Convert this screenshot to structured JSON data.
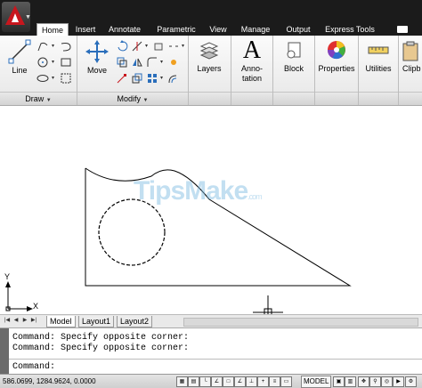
{
  "tabs": [
    "Home",
    "Insert",
    "Annotate",
    "Parametric",
    "View",
    "Manage",
    "Output",
    "Express Tools"
  ],
  "active_tab": "Home",
  "ribbon": {
    "draw_panel_label": "Draw",
    "modify_panel_label": "Modify",
    "line_label": "Line",
    "move_label": "Move",
    "layers_label": "Layers",
    "annotation_label_1": "Anno-",
    "annotation_label_2": "tation",
    "annotation_glyph": "A",
    "block_label": "Block",
    "properties_label": "Properties",
    "utilities_label": "Utilities",
    "clipboard_label": "Clipb"
  },
  "watermark": {
    "text": "TipsMake",
    "suffix": ".com"
  },
  "ucs": {
    "x_label": "X",
    "y_label": "Y"
  },
  "layout_tabs": [
    "Model",
    "Layout1",
    "Layout2"
  ],
  "command": {
    "history": [
      "Command: Specify opposite corner:",
      "Command: Specify opposite corner:"
    ],
    "prompt": "Command:"
  },
  "status": {
    "coordinates": "586.0699, 1284.9624, 0.0000",
    "model_label": "MODEL"
  },
  "colors": {
    "accent": "#c8161d",
    "tabbar": "#1b1b1b",
    "ribbon": "#f0f0f0"
  }
}
